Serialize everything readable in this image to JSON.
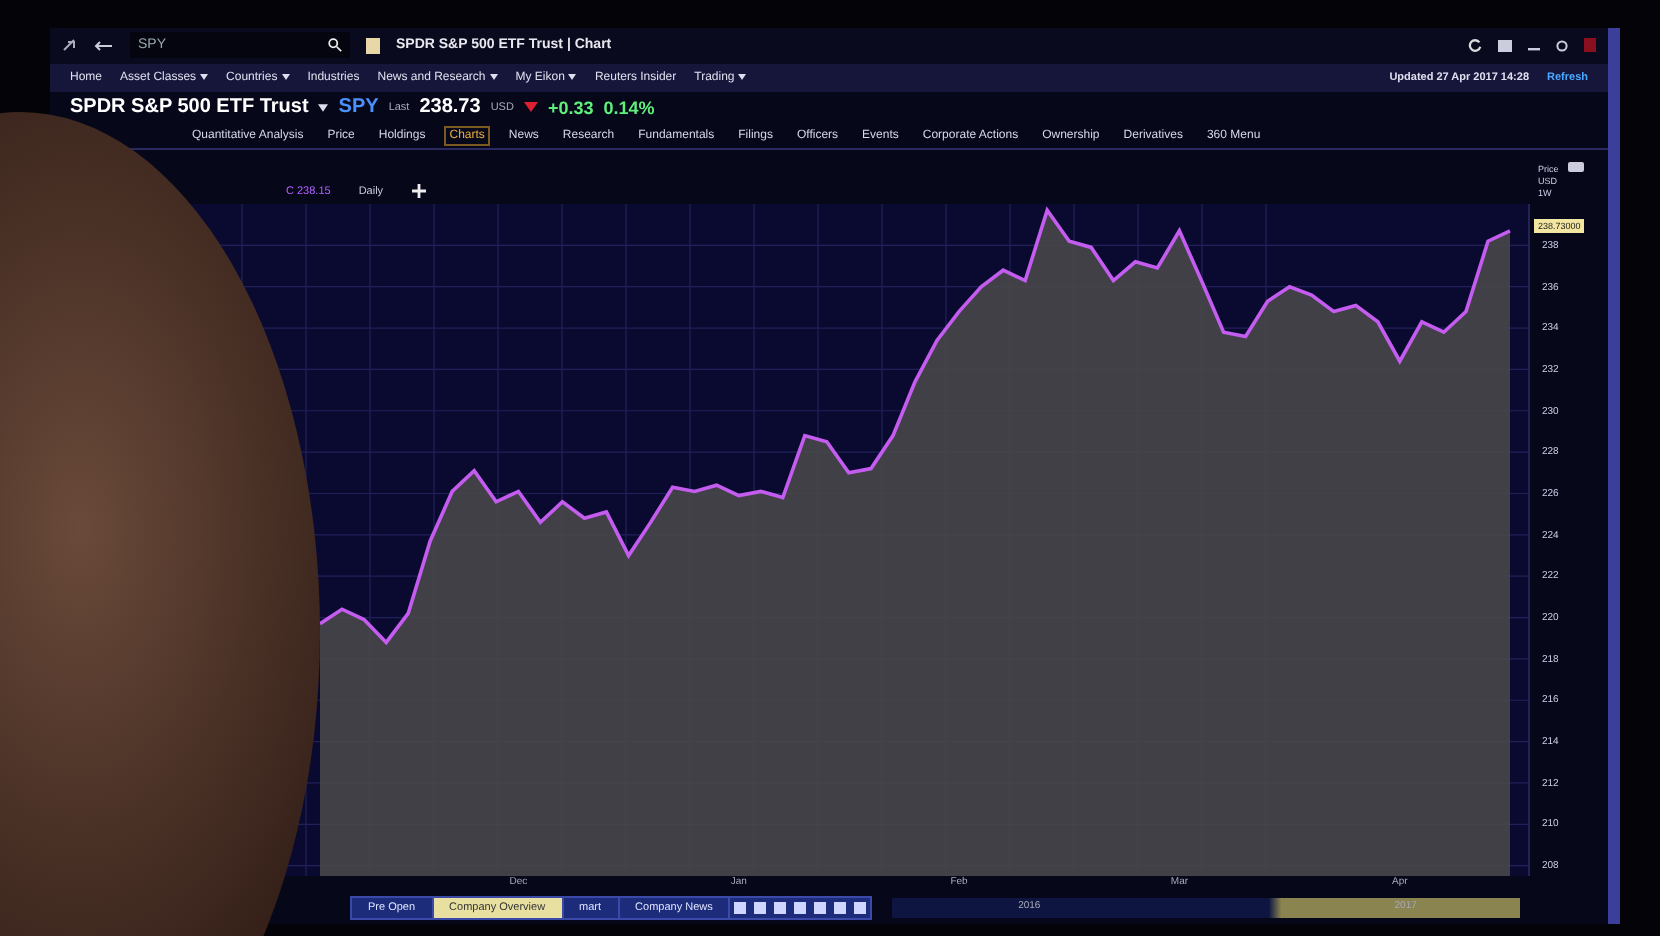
{
  "top_bar": {
    "search": {
      "value": "SPY"
    },
    "document_title": "SPDR S&P 500 ETF Trust | Chart"
  },
  "nav": [
    {
      "label": "Home",
      "has_menu": false
    },
    {
      "label": "Asset Classes",
      "has_menu": true
    },
    {
      "label": "Countries",
      "has_menu": true
    },
    {
      "label": "Industries",
      "has_menu": false
    },
    {
      "label": "News and Research",
      "has_menu": true
    },
    {
      "label": "My Eikon",
      "has_menu": true
    },
    {
      "label": "Reuters Insider",
      "has_menu": false
    },
    {
      "label": "Trading",
      "has_menu": true
    }
  ],
  "update": {
    "text": "Updated 27 Apr 2017 14:28",
    "refresh": "Refresh"
  },
  "quote": {
    "name": "SPDR S&P 500 ETF Trust",
    "ric": "SPY",
    "last_label": "Last",
    "last": "238.73",
    "currency": "USD",
    "change": "+0.33",
    "change_pct": "0.14%"
  },
  "tabs": [
    {
      "label": "Quantitative Analysis",
      "selected": false
    },
    {
      "label": "Price",
      "selected": false
    },
    {
      "label": "Holdings",
      "selected": false
    },
    {
      "label": "Charts",
      "selected": true
    },
    {
      "label": "News",
      "selected": false
    },
    {
      "label": "Research",
      "selected": false
    },
    {
      "label": "Fundamentals",
      "selected": false
    },
    {
      "label": "Filings",
      "selected": false
    },
    {
      "label": "Officers",
      "selected": false
    },
    {
      "label": "Events",
      "selected": false
    },
    {
      "label": "Corporate Actions",
      "selected": false
    },
    {
      "label": "Ownership",
      "selected": false
    },
    {
      "label": "Derivatives",
      "selected": false
    },
    {
      "label": "360 Menu",
      "selected": false
    }
  ],
  "chart_toolbar": {
    "series_label": "C 238.15",
    "interval": "Daily"
  },
  "axis_header": [
    "Price",
    "USD",
    "1W"
  ],
  "price_tag": "238.73000",
  "chart_data": {
    "type": "area",
    "grid": true,
    "ylim": [
      207.5,
      240
    ],
    "yticks": [
      208,
      210,
      212,
      214,
      216,
      218,
      220,
      222,
      224,
      226,
      228,
      230,
      232,
      234,
      236,
      238
    ],
    "series": [
      {
        "color": "#c45cf0",
        "values": [
          219.7,
          220.4,
          219.9,
          218.8,
          220.2,
          223.7,
          226.1,
          227.1,
          225.6,
          226.1,
          224.6,
          225.6,
          224.8,
          225.1,
          223.0,
          224.6,
          226.3,
          226.1,
          226.4,
          225.9,
          226.1,
          225.8,
          228.8,
          228.5,
          227.0,
          227.2,
          228.8,
          231.4,
          233.4,
          234.8,
          236.0,
          236.8,
          236.3,
          239.7,
          238.2,
          237.9,
          236.3,
          237.2,
          236.9,
          238.7,
          236.3,
          233.8,
          233.6,
          235.3,
          236.0,
          235.6,
          234.8,
          235.1,
          234.3,
          232.4,
          234.3,
          233.8,
          234.8,
          238.2,
          238.7
        ]
      }
    ]
  },
  "x_axis_labels": [
    "Dec",
    "Jan",
    "Feb",
    "Mar",
    "Apr"
  ],
  "navigator": {
    "labels": [
      "2016",
      "2017"
    ]
  },
  "taskbar": [
    {
      "label": "Pre Open",
      "selected": false
    },
    {
      "label": "Company Overview",
      "selected": true
    },
    {
      "label": "mart",
      "selected": false
    },
    {
      "label": "Company News",
      "selected": false
    }
  ]
}
